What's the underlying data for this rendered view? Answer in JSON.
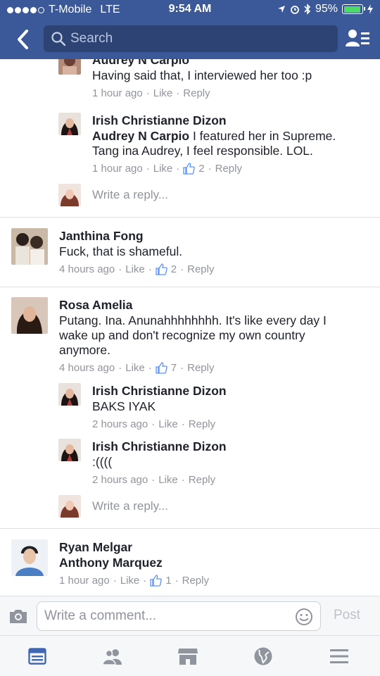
{
  "status_bar": {
    "carrier": "T-Mobile",
    "network": "LTE",
    "time": "9:54 AM",
    "battery": "95%",
    "battery_level": 0.95
  },
  "search": {
    "placeholder": "Search"
  },
  "comments": [
    {
      "name": "Audrey N Carpio",
      "text": "Having said that, I interviewed her too :p",
      "time": "1 hour ago",
      "like": "Like",
      "reply": "Reply"
    },
    {
      "name": "Irish Christianne Dizon",
      "mention": "Audrey N Carpio",
      "text": " I featured her in Supreme. Tang ina Audrey, I feel responsible. LOL.",
      "time": "1 hour ago",
      "like": "Like",
      "likes": "2",
      "reply": "Reply"
    },
    {
      "name": "Janthina Fong",
      "text": "Fuck, that is shameful.",
      "time": "4 hours ago",
      "like": "Like",
      "likes": "2",
      "reply": "Reply"
    },
    {
      "name": "Rosa Amelia",
      "text": "Putang. Ina. Anunahhhhhhhh. It's like every day I wake up and don't recognize my own country anymore.",
      "time": "4 hours ago",
      "like": "Like",
      "likes": "7",
      "reply": "Reply"
    },
    {
      "name": "Irish Christianne Dizon",
      "text": "BAKS IYAK",
      "time": "2 hours ago",
      "like": "Like",
      "reply": "Reply"
    },
    {
      "name": "Irish Christianne Dizon",
      "text": ":((((",
      "time": "2 hours ago",
      "like": "Like",
      "reply": "Reply"
    },
    {
      "name": "Ryan Melgar",
      "mention": "Anthony Marquez",
      "text": "",
      "time": "1 hour ago",
      "like": "Like",
      "likes": "1",
      "reply": "Reply"
    }
  ],
  "reply_placeholder": "Write a reply...",
  "composer": {
    "placeholder": "Write a comment...",
    "post_label": "Post"
  },
  "tabbar": {
    "items": [
      "news-feed",
      "friends",
      "marketplace",
      "notifications",
      "menu"
    ],
    "active": "news-feed"
  },
  "colors": {
    "brand": "#3b5998",
    "active_tab": "#4267b2",
    "muted": "#90949c"
  }
}
